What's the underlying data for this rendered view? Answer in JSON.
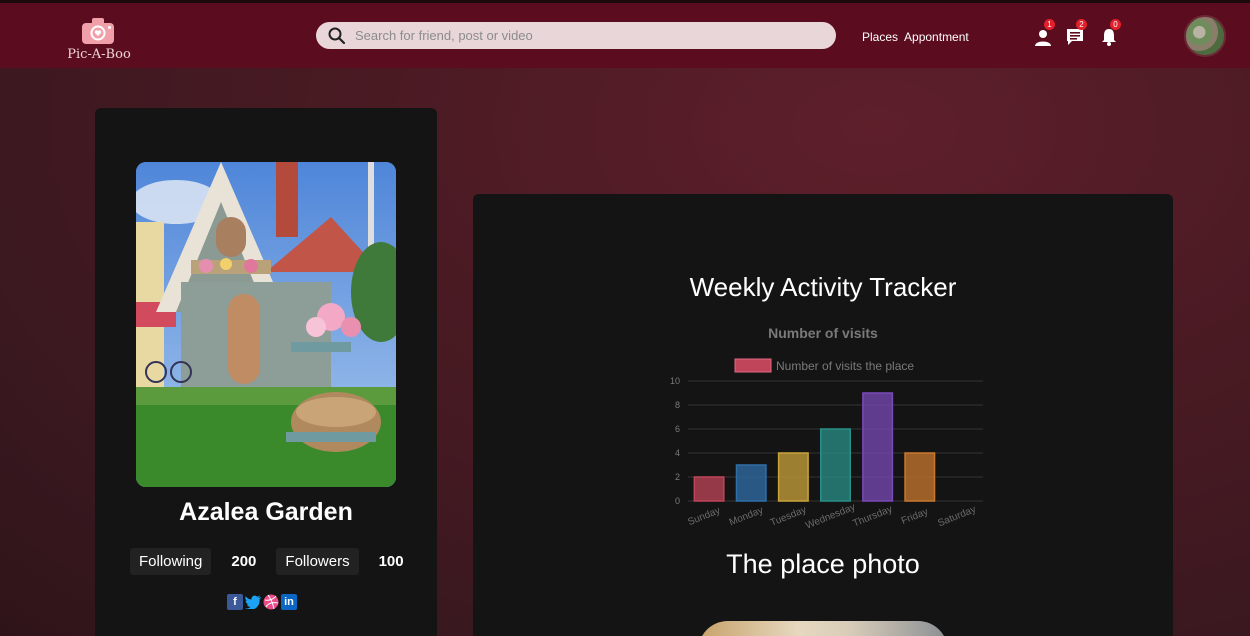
{
  "navbar": {
    "brand": "Pic-A-Boo",
    "search_placeholder": "Search for friend, post or video",
    "links": [
      "Places",
      "Appontment"
    ],
    "badges": {
      "friends": "1",
      "messages": "2",
      "notifications": "0"
    },
    "bg_color": "#5c0c1f"
  },
  "profile": {
    "name": "Azalea Garden",
    "following_label": "Following",
    "following_count": "200",
    "followers_label": "Followers",
    "followers_count": "100",
    "socials": [
      "facebook-icon",
      "twitter-icon",
      "dribbble-icon",
      "linkedin-icon"
    ]
  },
  "tracker": {
    "title": "Weekly Activity Tracker",
    "photo_heading": "The place photo"
  },
  "chart_data": {
    "type": "bar",
    "title": "Number of visits",
    "legend": "Number of visits the place",
    "categories": [
      "Sunday",
      "Monday",
      "Tuesday",
      "Wednesday",
      "Thursday",
      "Friday",
      "Saturday"
    ],
    "series": [
      {
        "name": "Number of visits the place",
        "values": [
          2,
          3,
          4,
          6,
          9,
          4,
          0
        ]
      }
    ],
    "colors": [
      "#c0445a",
      "#2f6fa8",
      "#c9a33a",
      "#2a8f88",
      "#7a4ab8",
      "#c9782e",
      "#888888"
    ],
    "ylim": [
      0,
      10
    ],
    "yticks": [
      0,
      2,
      4,
      6,
      8,
      10
    ],
    "grid": true,
    "legend_position": "top"
  }
}
